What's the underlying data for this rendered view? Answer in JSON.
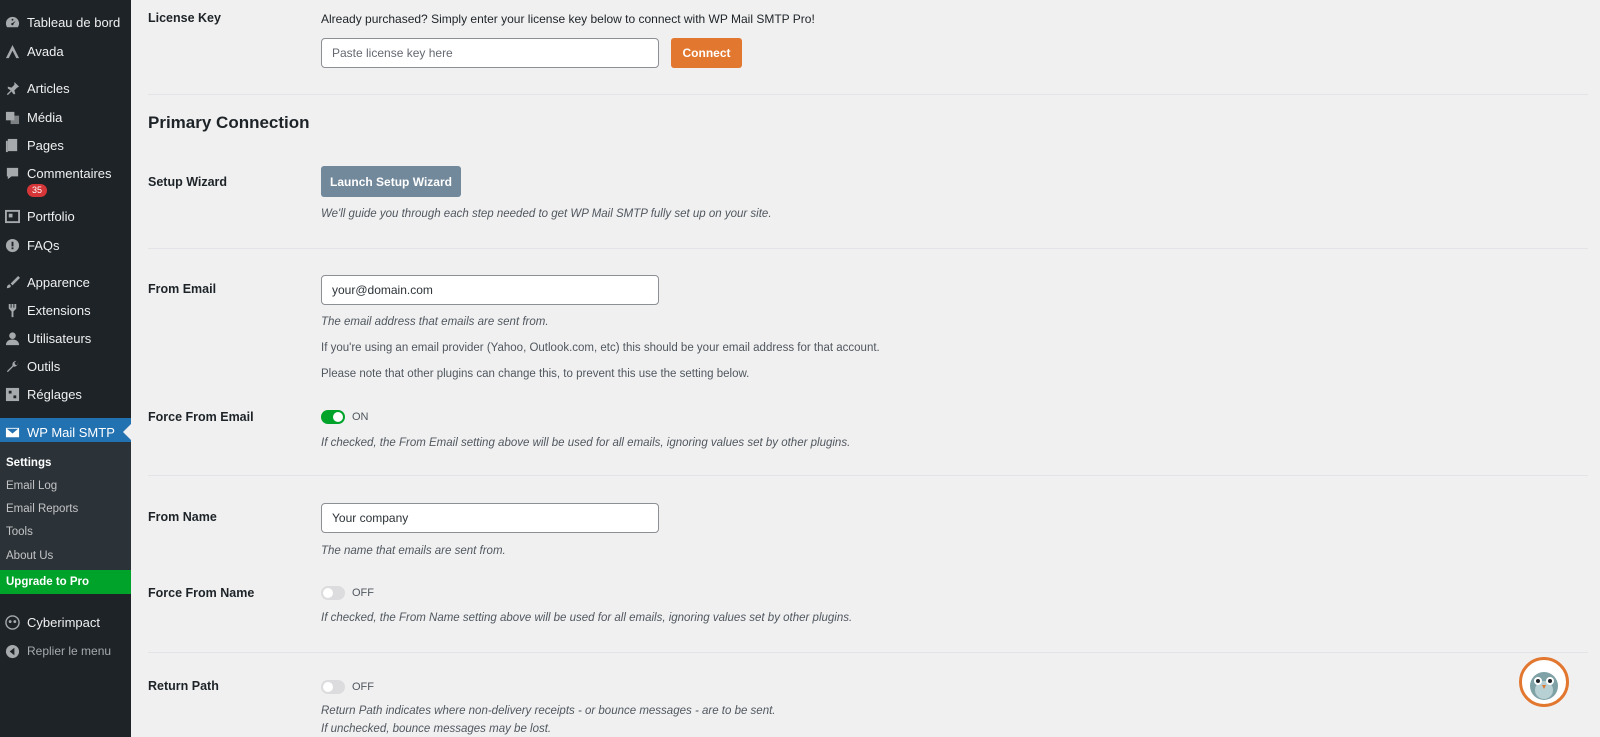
{
  "sidebar": {
    "items": [
      {
        "label": "Tableau de bord",
        "icon": "dashboard-icon"
      },
      {
        "label": "Avada",
        "icon": "avada-icon"
      },
      {
        "label": "Articles",
        "icon": "pin-icon"
      },
      {
        "label": "Média",
        "icon": "media-icon"
      },
      {
        "label": "Pages",
        "icon": "pages-icon"
      },
      {
        "label": "Commentaires",
        "icon": "comment-icon"
      },
      {
        "label": "Portfolio",
        "icon": "portfolio-icon"
      },
      {
        "label": "FAQs",
        "icon": "info-icon"
      },
      {
        "label": "Apparence",
        "icon": "brush-icon"
      },
      {
        "label": "Extensions",
        "icon": "plugin-icon"
      },
      {
        "label": "Utilisateurs",
        "icon": "user-icon"
      },
      {
        "label": "Outils",
        "icon": "wrench-icon"
      },
      {
        "label": "Réglages",
        "icon": "settings-icon"
      },
      {
        "label": "WP Mail SMTP",
        "icon": "mail-icon"
      },
      {
        "label": "Cyberimpact",
        "icon": "cyberimpact-icon"
      },
      {
        "label": "Replier le menu",
        "icon": "collapse-icon"
      }
    ],
    "comments_badge": "35",
    "submenu": [
      "Settings",
      "Email Log",
      "Email Reports",
      "Tools",
      "About Us"
    ],
    "upgrade": "Upgrade to Pro"
  },
  "license": {
    "label": "License Key",
    "intro": "Already purchased? Simply enter your license key below to connect with WP Mail SMTP Pro!",
    "placeholder": "Paste license key here",
    "connect": "Connect"
  },
  "primary": {
    "title": "Primary Connection",
    "wizard_label": "Setup Wizard",
    "wizard_button": "Launch Setup Wizard",
    "wizard_desc": "We'll guide you through each step needed to get WP Mail SMTP fully set up on your site.",
    "from_email_label": "From Email",
    "from_email_value": "your@domain.com",
    "from_email_desc": "The email address that emails are sent from.",
    "from_email_note1": "If you're using an email provider (Yahoo, Outlook.com, etc) this should be your email address for that account.",
    "from_email_note2": "Please note that other plugins can change this, to prevent this use the setting below.",
    "force_email_label": "Force From Email",
    "force_email_state": "ON",
    "force_email_desc": "If checked, the From Email setting above will be used for all emails, ignoring values set by other plugins.",
    "from_name_label": "From Name",
    "from_name_value": "Your company",
    "from_name_desc": "The name that emails are sent from.",
    "force_name_label": "Force From Name",
    "force_name_state": "OFF",
    "force_name_desc": "If checked, the From Name setting above will be used for all emails, ignoring values set by other plugins.",
    "return_path_label": "Return Path",
    "return_path_state": "OFF",
    "return_path_desc1": "Return Path indicates where non-delivery receipts - or bounce messages - are to be sent.",
    "return_path_desc2": "If unchecked, bounce messages may be lost."
  },
  "colors": {
    "accent": "#2271b1",
    "orange": "#e27730",
    "green": "#00a32a"
  }
}
